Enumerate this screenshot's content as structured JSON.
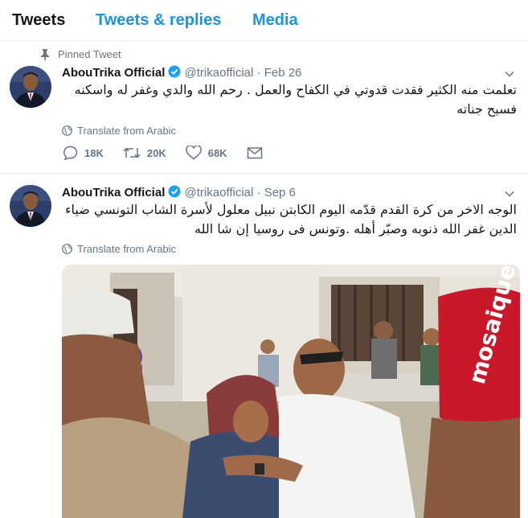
{
  "tabs": [
    {
      "label": "Tweets"
    },
    {
      "label": "Tweets & replies"
    },
    {
      "label": "Media"
    }
  ],
  "tweets": [
    {
      "pinned_label": "Pinned Tweet",
      "name": "AbouTrika Official",
      "handle": "@trikaofficial",
      "separator": "·",
      "date": "Feb 26",
      "text_line1": "تعلمت منه الكثير فقدت قدوتي في الكفاح والعمل . رحم الله والدي وغفر له واسكنه",
      "text_line2": "فسيح جناته",
      "translate": "Translate from Arabic",
      "replies": "18K",
      "retweets": "20K",
      "likes": "68K"
    },
    {
      "name": "AbouTrika Official",
      "handle": "@trikaofficial",
      "separator": "·",
      "date": "Sep 6",
      "text_line1": "الوجه الاخر من كرة القدم قدّمه اليوم الكابتن نبيل معلول لأسرة الشاب التونسي ضياء",
      "text_line2": "الدين غفر الله ذنوبه وصبّر أهله .وتونس فى روسيا إن شا الله",
      "translate": "Translate from Arabic",
      "photo_cap_text": "mosaique fm"
    }
  ],
  "colors": {
    "link_blue": "#1b95e0",
    "verified_blue": "#1da1f2",
    "muted_gray": "#657786",
    "divider": "#e6ecf0"
  }
}
